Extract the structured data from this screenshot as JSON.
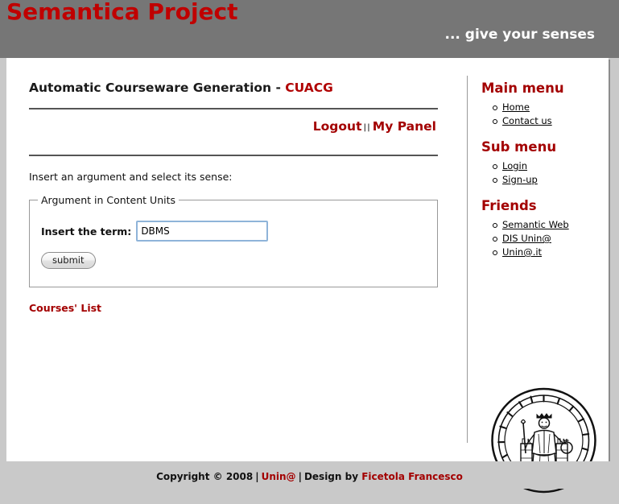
{
  "header": {
    "site_title": "Semantica Project",
    "tagline": "... give your senses",
    "band_color": "#767676",
    "title_color": "#c00000"
  },
  "main": {
    "page_title_prefix": "Automatic Courseware Generation - ",
    "page_title_accent": "CUACG",
    "auth": {
      "logout_label": "Logout",
      "separator": "||",
      "panel_label": "My Panel"
    },
    "intro_text": "Insert an argument and select its sense:",
    "fieldset": {
      "legend": "Argument in Content Units",
      "term_label": "Insert the term:",
      "term_value": "DBMS",
      "term_placeholder": "",
      "submit_label": "submit"
    },
    "courses_link": "Courses' List",
    "link_color": "#a30000"
  },
  "sidebar": {
    "blocks": [
      {
        "heading": "Main menu",
        "items": [
          {
            "label": "Home"
          },
          {
            "label": "Contact us"
          }
        ]
      },
      {
        "heading": "Sub menu",
        "items": [
          {
            "label": "Login"
          },
          {
            "label": "Sign-up"
          }
        ]
      },
      {
        "heading": "Friends",
        "items": [
          {
            "label": "Semantic Web"
          },
          {
            "label": "DIS Unin@"
          },
          {
            "label": "Unin@.it"
          }
        ]
      }
    ],
    "seal_name": "university-seal-federico-ii"
  },
  "footer": {
    "copyright": "Copyright © 2008",
    "pipe": "|",
    "org_link": "Unin@",
    "design_prefix": "Design by ",
    "designer": "Ficetola Francesco"
  }
}
